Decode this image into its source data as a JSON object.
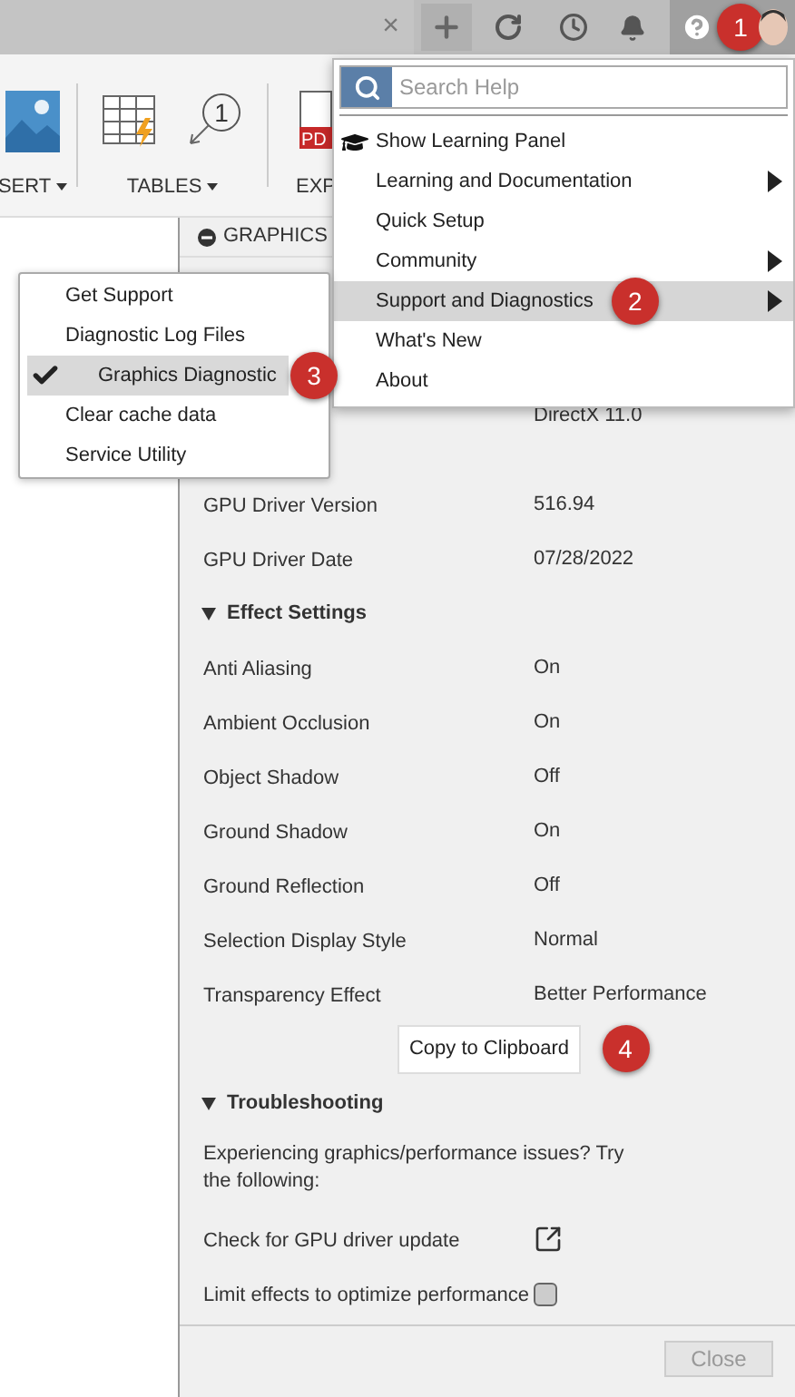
{
  "top_bar": {
    "tab_close": "×",
    "help_callout": "1"
  },
  "ribbon": {
    "groups": [
      {
        "kind": "insert",
        "label": "SERT",
        "dropdown": true
      },
      {
        "kind": "tables",
        "label": "TABLES",
        "dropdown": true,
        "balloon_number": "1"
      },
      {
        "kind": "export",
        "label": "EXP",
        "dropdown": false,
        "pdf_text": "PD"
      }
    ]
  },
  "panel": {
    "title": "GRAPHICS",
    "rows": [
      {
        "kind": "field",
        "value": "DirectX 11.0"
      },
      {
        "kind": "field",
        "label": "GPU Driver Version",
        "value": "516.94"
      },
      {
        "kind": "field",
        "label": "GPU Driver Date",
        "value": "07/28/2022"
      },
      {
        "kind": "section",
        "label": "Effect Settings",
        "expanded": true
      },
      {
        "kind": "field",
        "label": "Anti Aliasing",
        "value": "On"
      },
      {
        "kind": "field",
        "label": "Ambient Occlusion",
        "value": "On"
      },
      {
        "kind": "field",
        "label": "Object Shadow",
        "value": "Off"
      },
      {
        "kind": "field",
        "label": "Ground Shadow",
        "value": "On"
      },
      {
        "kind": "field",
        "label": "Ground Reflection",
        "value": "Off"
      },
      {
        "kind": "field",
        "label": "Selection Display Style",
        "value": "Normal"
      },
      {
        "kind": "field",
        "label": "Transparency Effect",
        "value": "Better Performance"
      },
      {
        "kind": "button",
        "label": "Copy to Clipboard",
        "callout": "4"
      },
      {
        "kind": "section",
        "label": "Troubleshooting",
        "expanded": true
      },
      {
        "kind": "paragraph",
        "label": "Experiencing graphics/performance issues? Try the following:"
      },
      {
        "kind": "link",
        "label": "Check for GPU driver update"
      },
      {
        "kind": "checkbox",
        "label": "Limit effects to optimize performance",
        "checked": false
      }
    ],
    "close_button": "Close"
  },
  "help_menu": {
    "search": {
      "placeholder": "Search Help"
    },
    "items": [
      {
        "label": "Show Learning Panel",
        "has_icon": true,
        "submenu": false,
        "selected": false
      },
      {
        "label": "Learning and Documentation",
        "has_icon": false,
        "submenu": true,
        "selected": false
      },
      {
        "label": "Quick Setup",
        "has_icon": false,
        "submenu": false,
        "selected": false
      },
      {
        "label": "Community",
        "has_icon": false,
        "submenu": true,
        "selected": false
      },
      {
        "label": "Support and Diagnostics",
        "has_icon": false,
        "submenu": true,
        "selected": true,
        "callout": "2"
      },
      {
        "label": "What's New",
        "has_icon": false,
        "submenu": false,
        "selected": false
      },
      {
        "label": "About",
        "has_icon": false,
        "submenu": false,
        "selected": false
      }
    ]
  },
  "submenu": {
    "items": [
      {
        "label": "Get Support",
        "selected": false
      },
      {
        "label": "Diagnostic Log Files",
        "selected": false
      },
      {
        "label": "Graphics Diagnostic",
        "selected": true,
        "callout": "3"
      },
      {
        "label": "Clear cache data",
        "selected": false
      },
      {
        "label": "Service Utility",
        "selected": false
      }
    ]
  }
}
